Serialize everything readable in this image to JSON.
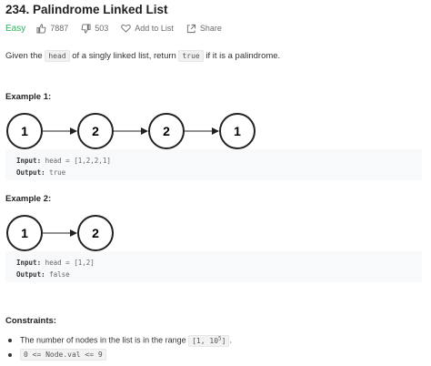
{
  "problem": {
    "title": "234. Palindrome Linked List",
    "difficulty": "Easy",
    "likes": "7887",
    "dislikes": "503",
    "add_to_list": "Add to List",
    "share": "Share"
  },
  "description": {
    "part1": "Given the ",
    "code1": "head",
    "part2": " of a singly linked list, return ",
    "code2": "true",
    "part3": " if it is a palindrome."
  },
  "example1": {
    "heading": "Example 1:",
    "nodes": [
      "1",
      "2",
      "2",
      "1"
    ],
    "input_label": "Input:",
    "input_value": " head = [1,2,2,1]",
    "output_label": "Output:",
    "output_value": " true"
  },
  "example2": {
    "heading": "Example 2:",
    "nodes": [
      "1",
      "2"
    ],
    "input_label": "Input:",
    "input_value": " head = [1,2]",
    "output_label": "Output:",
    "output_value": " false"
  },
  "constraints": {
    "heading": "Constraints:",
    "c1_text": "The number of nodes in the list is in the range ",
    "c1_code_a": "[1, 10",
    "c1_code_sup": "5",
    "c1_code_b": "]",
    "c1_end": ".",
    "c2_code": "0 <= Node.val <= 9"
  },
  "colors": {
    "easy": "#2db55d",
    "node_stroke": "#222222"
  }
}
